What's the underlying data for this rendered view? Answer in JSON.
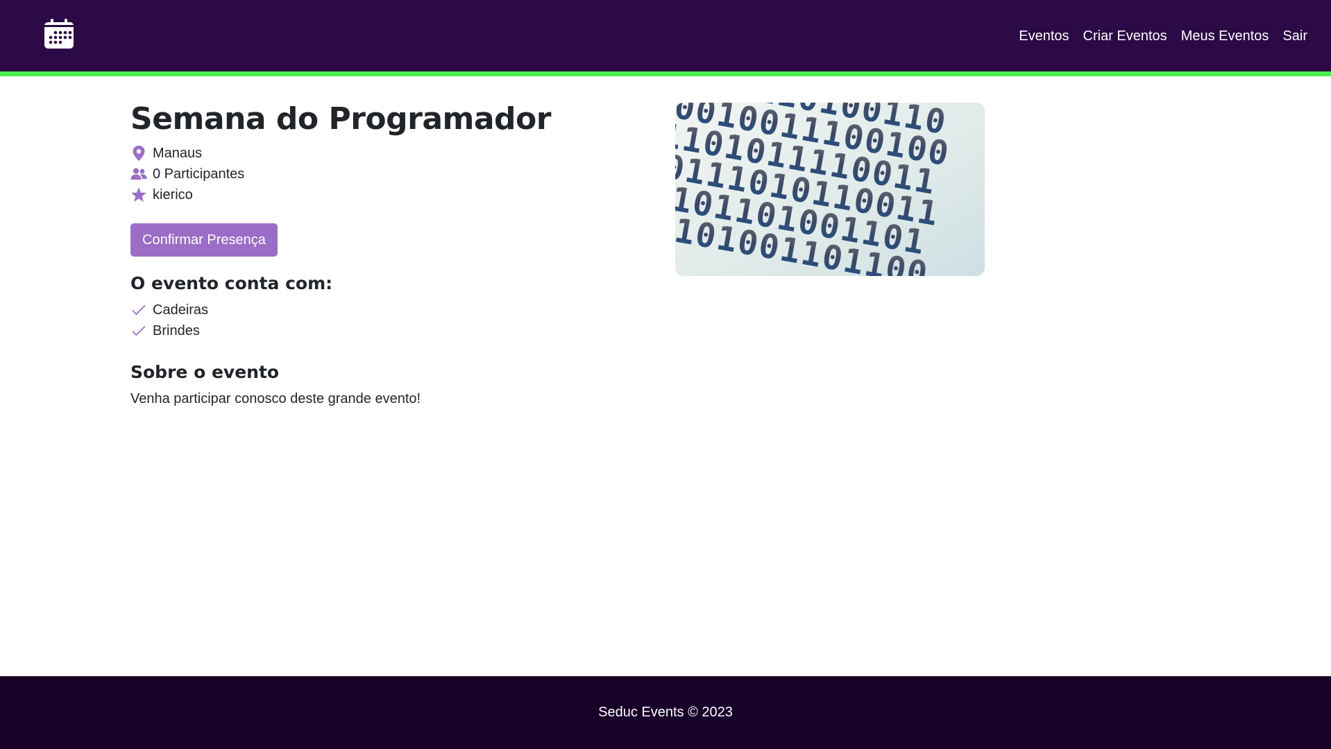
{
  "header": {
    "logo_icon": "calendar-icon",
    "nav": [
      {
        "label": "Eventos"
      },
      {
        "label": "Criar Eventos"
      },
      {
        "label": "Meus Eventos"
      },
      {
        "label": "Sair"
      }
    ],
    "colors": {
      "background": "#2b0a45",
      "accent": "#4cef52"
    }
  },
  "event": {
    "title": "Semana do Programador",
    "city": "Manaus",
    "participants": "0 Participantes",
    "owner": "kierico",
    "confirm_label": "Confirmar Presença",
    "features_title": "O evento conta com:",
    "features": [
      "Cadeiras",
      "Brindes"
    ],
    "about_title": "Sobre o evento",
    "about_text": "Venha participar conosco deste grande evento!",
    "image": {
      "description_icon": "binary-code-image",
      "digits": [
        "1010110100110",
        "0010011100100",
        "1101011110011",
        "0111010110011",
        "1101101001101",
        "0101001101100"
      ]
    },
    "colors": {
      "icon": "#9b6dc6",
      "button": "#9b6dc6"
    }
  },
  "footer": {
    "text": "Seduc Events © 2023",
    "background": "#190029"
  }
}
